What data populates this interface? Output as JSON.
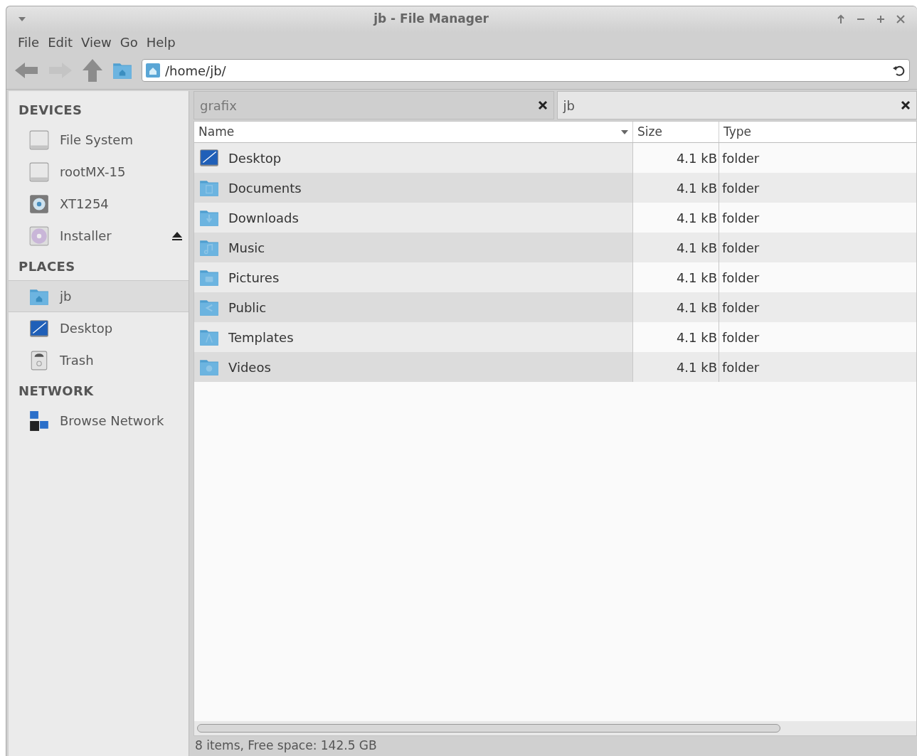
{
  "window": {
    "title": "jb - File Manager"
  },
  "menu": [
    "File",
    "Edit",
    "View",
    "Go",
    "Help"
  ],
  "location": {
    "value": "/home/jb/"
  },
  "sidebar": {
    "sections": [
      {
        "heading": "DEVICES",
        "items": [
          {
            "label": "File System",
            "kind": "drive",
            "selected": false,
            "eject": false
          },
          {
            "label": "rootMX-15",
            "kind": "drive",
            "selected": false,
            "eject": false
          },
          {
            "label": "XT1254",
            "kind": "phone",
            "selected": false,
            "eject": false
          },
          {
            "label": "Installer",
            "kind": "disc",
            "selected": false,
            "eject": true
          }
        ]
      },
      {
        "heading": "PLACES",
        "items": [
          {
            "label": "jb",
            "kind": "home",
            "selected": true,
            "eject": false
          },
          {
            "label": "Desktop",
            "kind": "desktop",
            "selected": false,
            "eject": false
          },
          {
            "label": "Trash",
            "kind": "trash",
            "selected": false,
            "eject": false
          }
        ]
      },
      {
        "heading": "NETWORK",
        "items": [
          {
            "label": "Browse Network",
            "kind": "network",
            "selected": false,
            "eject": false
          }
        ]
      }
    ]
  },
  "tabs": [
    {
      "label": "grafix",
      "selected": false
    },
    {
      "label": "jb",
      "selected": true
    }
  ],
  "table": {
    "columns": [
      "Name",
      "Size",
      "Type"
    ],
    "rows": [
      {
        "name": "Desktop",
        "kind": "desktop",
        "size": "4.1 kB",
        "type": "folder"
      },
      {
        "name": "Documents",
        "kind": "documents",
        "size": "4.1 kB",
        "type": "folder"
      },
      {
        "name": "Downloads",
        "kind": "downloads",
        "size": "4.1 kB",
        "type": "folder"
      },
      {
        "name": "Music",
        "kind": "music",
        "size": "4.1 kB",
        "type": "folder"
      },
      {
        "name": "Pictures",
        "kind": "pictures",
        "size": "4.1 kB",
        "type": "folder"
      },
      {
        "name": "Public",
        "kind": "public",
        "size": "4.1 kB",
        "type": "folder"
      },
      {
        "name": "Templates",
        "kind": "templates",
        "size": "4.1 kB",
        "type": "folder"
      },
      {
        "name": "Videos",
        "kind": "videos",
        "size": "4.1 kB",
        "type": "folder"
      }
    ]
  },
  "status_bar": "8 items, Free space: 142.5 GB"
}
